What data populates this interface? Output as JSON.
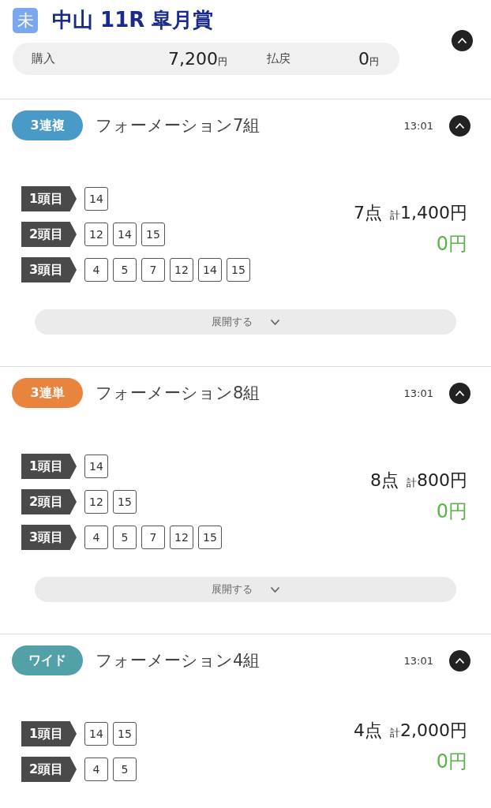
{
  "race": {
    "status_badge": "未",
    "title": "中山 11R 皐月賞",
    "expanded": true
  },
  "summary": {
    "purchase_label": "購入",
    "purchase_amount": "7,200",
    "purchase_unit": "円",
    "payout_label": "払戻",
    "payout_amount": "0",
    "payout_unit": "円"
  },
  "bets": [
    {
      "type": "3連複",
      "color": "#4a9ac8",
      "title": "フォーメーション7組",
      "time": "13:01",
      "expanded": true,
      "legs": [
        {
          "label": "1頭目",
          "numbers": [
            "14"
          ]
        },
        {
          "label": "2頭目",
          "numbers": [
            "12",
            "14",
            "15"
          ]
        },
        {
          "label": "3頭目",
          "numbers": [
            "4",
            "5",
            "7",
            "12",
            "14",
            "15"
          ]
        }
      ],
      "points": "7点",
      "total_prefix": "計",
      "total": "1,400円",
      "payout": "0円",
      "expand_label": "展開する"
    },
    {
      "type": "3連単",
      "color": "#e8843e",
      "title": "フォーメーション8組",
      "time": "13:01",
      "expanded": true,
      "legs": [
        {
          "label": "1頭目",
          "numbers": [
            "14"
          ]
        },
        {
          "label": "2頭目",
          "numbers": [
            "12",
            "15"
          ]
        },
        {
          "label": "3頭目",
          "numbers": [
            "4",
            "5",
            "7",
            "12",
            "15"
          ]
        }
      ],
      "points": "8点",
      "total_prefix": "計",
      "total": "800円",
      "payout": "0円",
      "expand_label": "展開する"
    },
    {
      "type": "ワイド",
      "color": "#52a0a8",
      "title": "フォーメーション4組",
      "time": "13:01",
      "expanded": true,
      "legs": [
        {
          "label": "1頭目",
          "numbers": [
            "14",
            "15"
          ]
        },
        {
          "label": "2頭目",
          "numbers": [
            "4",
            "5"
          ]
        }
      ],
      "points": "4点",
      "total_prefix": "計",
      "total": "2,000円",
      "payout": "0円"
    }
  ]
}
